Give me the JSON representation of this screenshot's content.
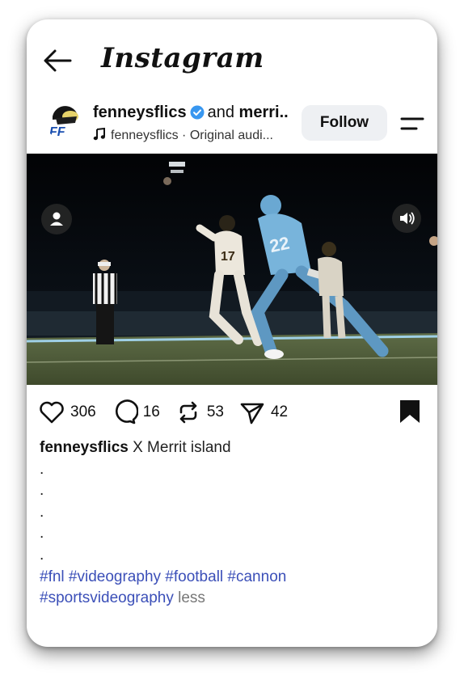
{
  "header": {
    "app_name": "Instagram"
  },
  "post": {
    "username": "fenneysflics",
    "and_text": "and",
    "collaborator": "merri..",
    "audio": "fenneysflics · Original audi...",
    "follow_label": "Follow",
    "likes": "306",
    "comments": "16",
    "reposts": "53",
    "shares": "42",
    "caption_user": "fenneysflics",
    "caption_text": "X Merrit island",
    "caption_dots": [
      ".",
      ".",
      ".",
      ".",
      "."
    ],
    "hashtags_line1": [
      "#fnl",
      "#videography",
      "#football",
      "#cannon"
    ],
    "hashtags_line2": [
      "#sportsvideography"
    ],
    "less_label": "less"
  },
  "icons": {
    "back": "back-arrow-icon",
    "verified": "verified-badge-icon",
    "audio": "music-note-icon",
    "menu": "menu-icon",
    "like": "heart-icon",
    "comment": "comment-icon",
    "repost": "repost-icon",
    "share": "send-icon",
    "save": "bookmark-icon",
    "tag": "person-icon",
    "sound": "speaker-icon"
  },
  "colors": {
    "accent_link": "#3b4fb8",
    "verified": "#3897f0",
    "follow_bg": "#eef0f3"
  }
}
